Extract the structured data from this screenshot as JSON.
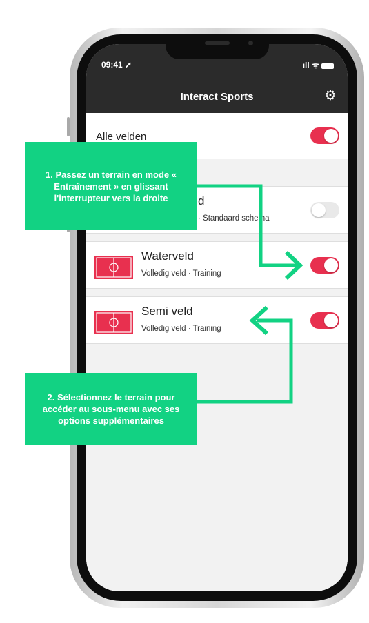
{
  "status_bar": {
    "time": "09:41",
    "icons": "ıll ᯤ"
  },
  "header": {
    "title": "Interact Sports",
    "settings_icon": "gear-icon"
  },
  "all_fields": {
    "label": "Alle velden",
    "toggle_on": true
  },
  "fields": [
    {
      "name": "d",
      "subtitle": "· Standaard schema",
      "toggle_on": false
    },
    {
      "name": "Waterveld",
      "subtitle": "Volledig veld · Training",
      "toggle_on": true
    },
    {
      "name": "Semi veld",
      "subtitle": "Volledig veld · Training",
      "toggle_on": true
    }
  ],
  "callouts": {
    "step1": "1. Passez un terrain en mode « Entraînement » en glissant l'interrupteur vers la droite",
    "step2": "2. Sélectionnez le terrain pour accéder au sous-menu avec ses options supplémentaires"
  },
  "colors": {
    "accent": "#e8304f",
    "callout": "#12d283",
    "header": "#2b2b2b"
  }
}
